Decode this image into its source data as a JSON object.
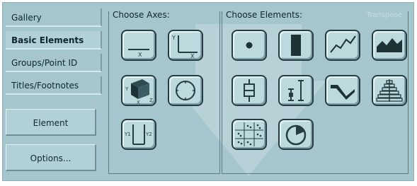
{
  "nav": {
    "tabs": [
      {
        "label": "Gallery"
      },
      {
        "label": "Basic Elements"
      },
      {
        "label": "Groups/Point ID"
      },
      {
        "label": "Titles/Footnotes"
      }
    ],
    "element_properties_label": "Element Properties...",
    "options_label": "Options..."
  },
  "axes_panel": {
    "title": "Choose Axes:"
  },
  "elements_panel": {
    "title": "Choose Elements:",
    "transpose_label": "Transpose"
  },
  "colors": {
    "dialog_bg": "#a4c6cc",
    "button_bg": "#bcd9de",
    "icon_stroke": "#243c42"
  }
}
